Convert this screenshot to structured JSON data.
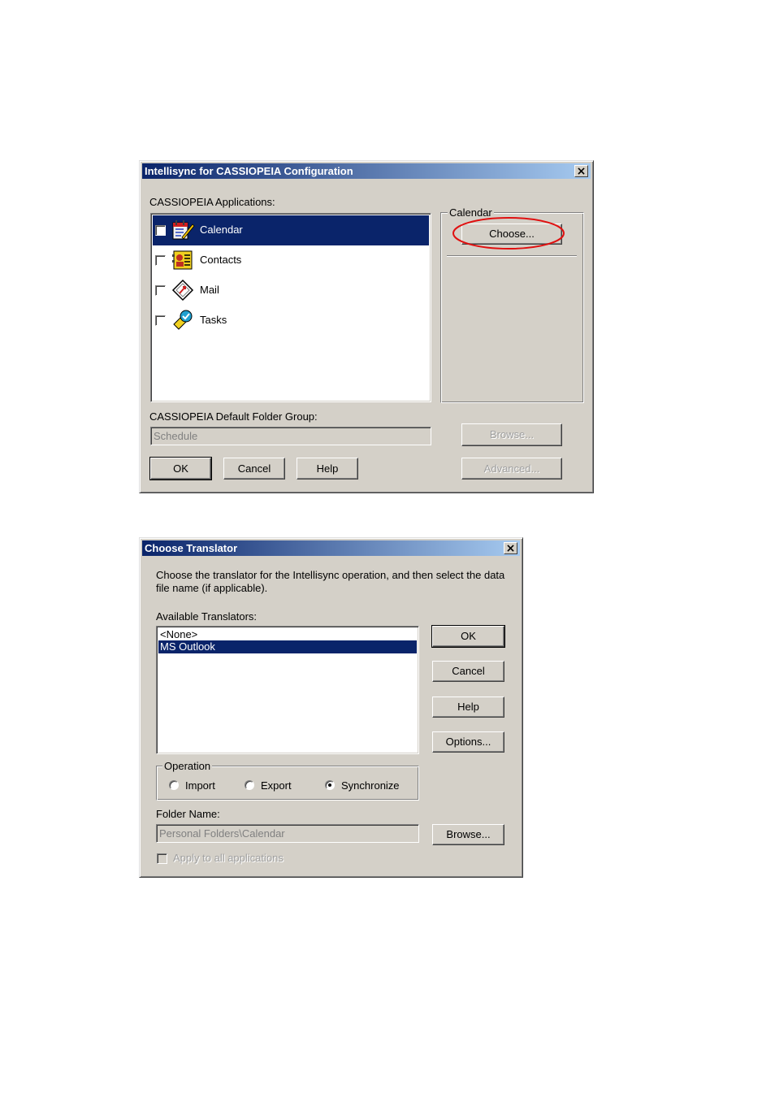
{
  "dialog1": {
    "title": "Intellisync for CASSIOPEIA Configuration",
    "close_label": "x",
    "apps_label": "CASSIOPEIA Applications:",
    "apps": [
      {
        "label": "Calendar",
        "icon": "calendar-icon",
        "selected": true,
        "checked": false
      },
      {
        "label": "Contacts",
        "icon": "contacts-icon",
        "selected": false,
        "checked": false
      },
      {
        "label": "Mail",
        "icon": "mail-icon",
        "selected": false,
        "checked": false
      },
      {
        "label": "Tasks",
        "icon": "tasks-icon",
        "selected": false,
        "checked": false
      }
    ],
    "group_title": "Calendar",
    "choose_label": "Choose...",
    "folder_group_label": "CASSIOPEIA Default Folder Group:",
    "folder_group_value": "Schedule",
    "browse_label": "Browse...",
    "ok_label": "OK",
    "cancel_label": "Cancel",
    "help_label": "Help",
    "advanced_label": "Advanced...",
    "highlight_color": "#e01010"
  },
  "dialog2": {
    "title": "Choose Translator",
    "close_label": "x",
    "instruction": "Choose the translator for the Intellisync operation, and then select the data file name (if applicable).",
    "instruction_line1": "Choose the translator for the Intellisync operation, and then select the data",
    "instruction_line2": "file name (if applicable).",
    "translators_label": "Available Translators:",
    "translators": [
      {
        "label": "<None>",
        "selected": false
      },
      {
        "label": "MS Outlook",
        "selected": true
      }
    ],
    "ok_label": "OK",
    "cancel_label": "Cancel",
    "help_label": "Help",
    "options_label": "Options...",
    "operation_title": "Operation",
    "operations": [
      {
        "label": "Import",
        "selected": false
      },
      {
        "label": "Export",
        "selected": false
      },
      {
        "label": "Synchronize",
        "selected": true
      }
    ],
    "folder_name_label": "Folder Name:",
    "folder_name_value": "Personal Folders\\Calendar",
    "browse_label": "Browse...",
    "apply_all_label": "Apply to all applications"
  },
  "colors": {
    "face": "#d4d0c8",
    "selection": "#0a246a",
    "title_start": "#0a246a",
    "title_end": "#a6caf0"
  }
}
